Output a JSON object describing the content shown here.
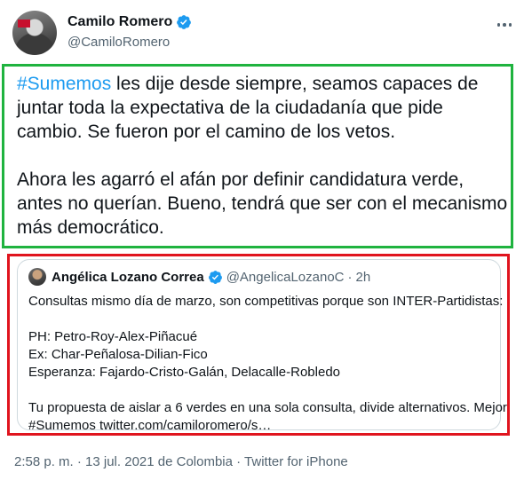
{
  "author": {
    "display_name": "Camilo Romero",
    "handle": "@CamiloRomero"
  },
  "tweet": {
    "hashtag": "#Sumemos",
    "text_after_hashtag": " les dije desde siempre, seamos capaces de juntar toda la expectativa de la ciudadanía que pide cambio. Se fueron por el camino de los vetos.",
    "paragraph_2": "Ahora les agarró el afán por definir candidatura verde, antes no querían. Bueno, tendrá que ser con el mecanismo más democrático."
  },
  "quote": {
    "display_name": "Angélica Lozano Correa",
    "handle": "@AngelicaLozanoC",
    "separator": "·",
    "time": "2h",
    "lines": [
      "Consultas mismo día de marzo, son competitivas porque son INTER-Partidistas:",
      "",
      "PH: Petro-Roy-Alex-Piñacué",
      "Ex: Char-Peñalosa-Dilian-Fico",
      "Esperanza: Fajardo-Cristo-Galán, Delacalle-Robledo",
      "",
      "Tu propuesta de aislar a 6 verdes en una sola consulta, divide alternativos. Mejor",
      "#Sumemos twitter.com/camiloromero/s…"
    ]
  },
  "meta": {
    "timestamp": "2:58 p. m. · 13 jul. 2021 de Colombia · Twitter for iPhone"
  },
  "colors": {
    "accent": "#1d9bf0",
    "green_highlight": "#1fb33f",
    "red_highlight": "#e0141e"
  }
}
